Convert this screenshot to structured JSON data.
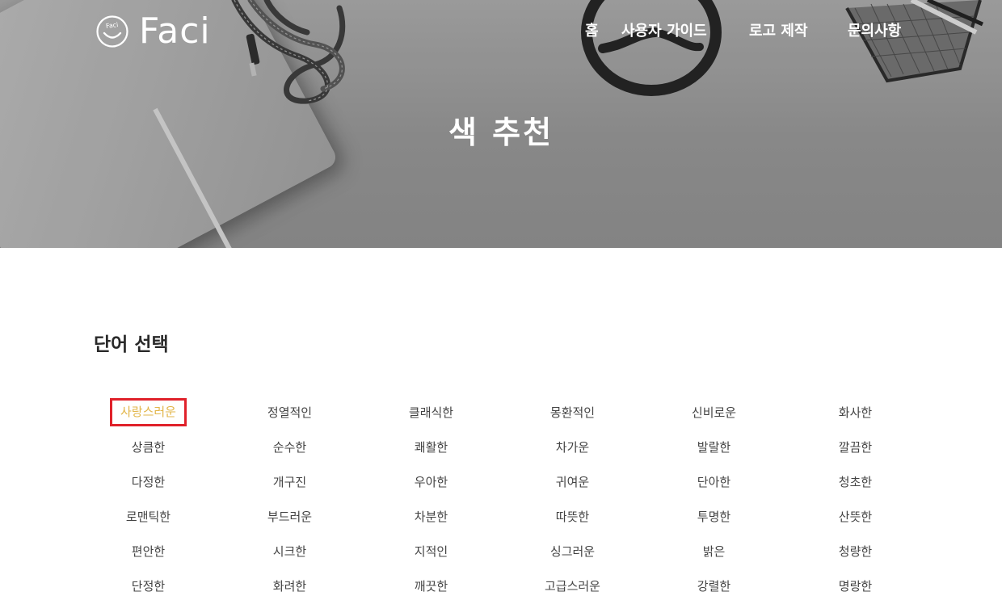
{
  "header": {
    "logo_text": "Faci",
    "logo_mark_text": "Faci",
    "nav": [
      "홈",
      "사용자 가이드",
      "로고 제작",
      "문의사항"
    ]
  },
  "hero": {
    "title": "색 추천"
  },
  "word_section": {
    "title": "단어 선택",
    "selected_word": "사랑스러운",
    "selected_color": "#e2b64a",
    "highlight_border_color": "#e0212a",
    "words": [
      "사랑스러운",
      "정열적인",
      "클래식한",
      "몽환적인",
      "신비로운",
      "화사한",
      "상큼한",
      "순수한",
      "쾌활한",
      "차가운",
      "발랄한",
      "깔끔한",
      "다정한",
      "개구진",
      "우아한",
      "귀여운",
      "단아한",
      "청초한",
      "로맨틱한",
      "부드러운",
      "차분한",
      "따뜻한",
      "투명한",
      "산뜻한",
      "편안한",
      "시크한",
      "지적인",
      "싱그러운",
      "밝은",
      "청량한",
      "단정한",
      "화려한",
      "깨끗한",
      "고급스러운",
      "강렬한",
      "명랑한"
    ]
  }
}
